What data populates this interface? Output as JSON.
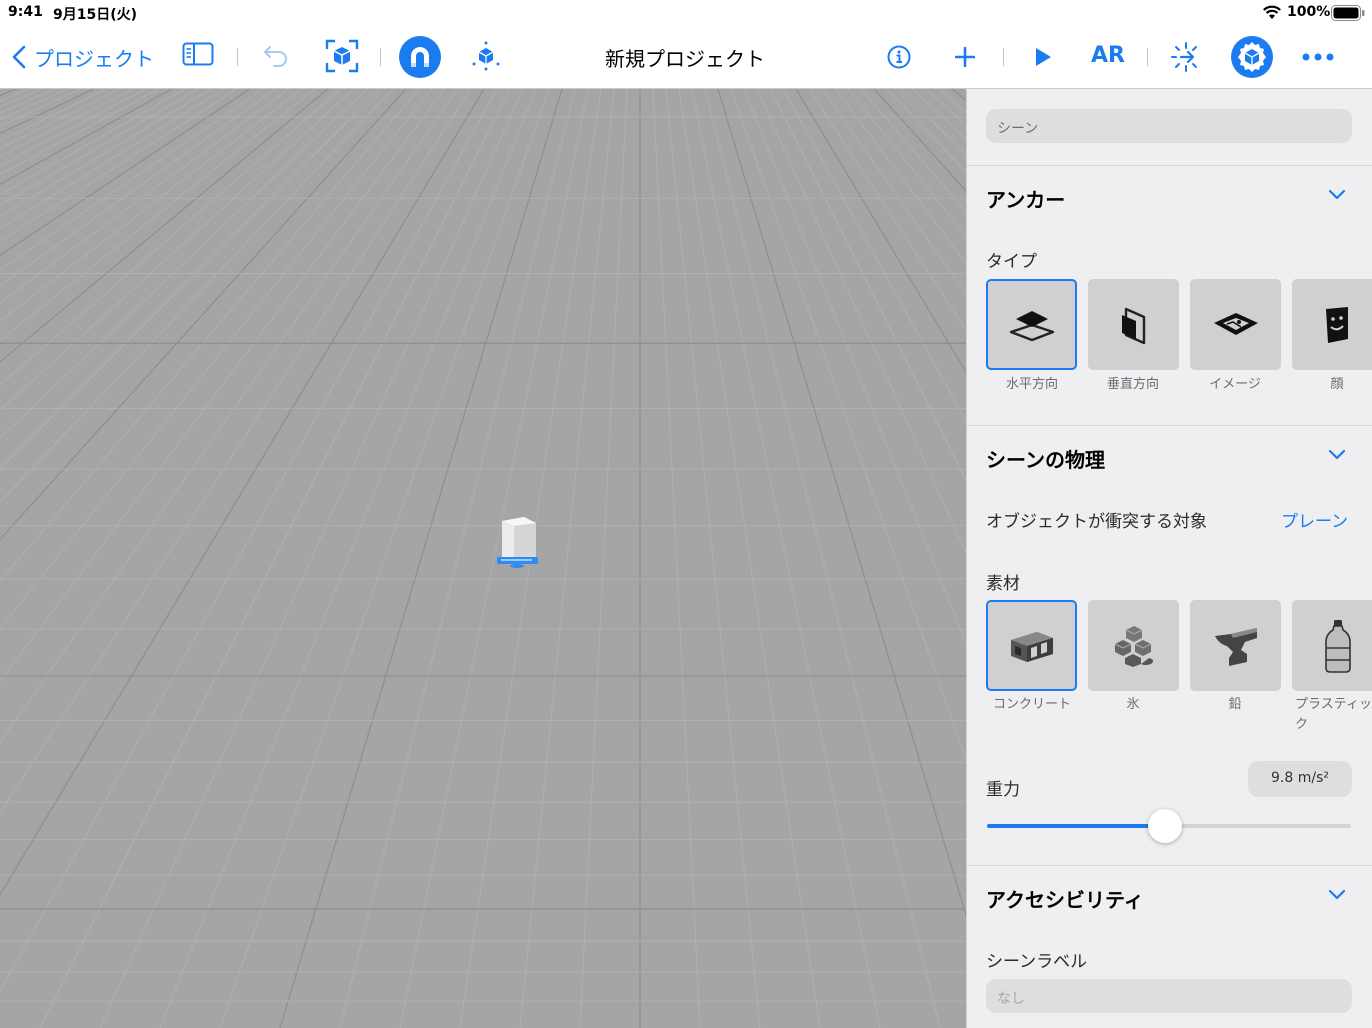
{
  "status": {
    "time": "9:41",
    "date": "9月15日(火)",
    "battery": "100%"
  },
  "toolbar": {
    "back_label": "プロジェクト",
    "title": "新規プロジェクト",
    "ar_label": "AR"
  },
  "inspector": {
    "scene_field": "シーン",
    "anchor": {
      "title": "アンカー",
      "type_label": "タイプ",
      "types": [
        "水平方向",
        "垂直方向",
        "イメージ",
        "顔"
      ],
      "selected_index": 0
    },
    "physics": {
      "title": "シーンの物理",
      "collide_label": "オブジェクトが衝突する対象",
      "collide_value": "プレーン",
      "material_label": "素材",
      "materials": [
        "コンクリート",
        "氷",
        "鉛",
        "プラスティック"
      ],
      "selected_index": 0,
      "gravity_label": "重力",
      "gravity_value": "9.8 m/s²",
      "gravity_fraction": 0.49
    },
    "accessibility": {
      "title": "アクセシビリティ",
      "scene_label": "シーンラベル",
      "scene_label_placeholder": "なし"
    }
  },
  "colors": {
    "accent": "#1a7cf0",
    "viewport": "#a5a5a5",
    "panel": "#efeff1"
  }
}
